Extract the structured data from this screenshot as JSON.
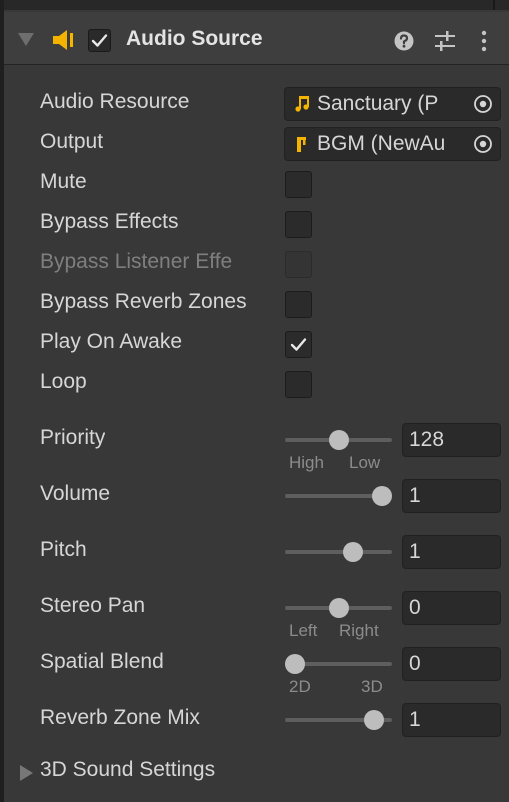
{
  "component": {
    "title": "Audio Source",
    "enabled": true
  },
  "fields": {
    "audio_resource": {
      "label": "Audio Resource",
      "value": "Sanctuary (P"
    },
    "output": {
      "label": "Output",
      "value": "BGM (NewAu"
    },
    "mute": {
      "label": "Mute",
      "checked": false
    },
    "bypass_effects": {
      "label": "Bypass Effects",
      "checked": false
    },
    "bypass_listener_effects": {
      "label": "Bypass Listener Effe",
      "checked": false,
      "disabled": true
    },
    "bypass_reverb_zones": {
      "label": "Bypass Reverb Zones",
      "checked": false
    },
    "play_on_awake": {
      "label": "Play On Awake",
      "checked": true
    },
    "loop": {
      "label": "Loop",
      "checked": false
    },
    "priority": {
      "label": "Priority",
      "value": "128",
      "slider_fraction": 0.5,
      "min_label": "High",
      "max_label": "Low"
    },
    "volume": {
      "label": "Volume",
      "value": "1",
      "slider_fraction": 1.0
    },
    "pitch": {
      "label": "Pitch",
      "value": "1",
      "slider_fraction": 0.67
    },
    "stereo_pan": {
      "label": "Stereo Pan",
      "value": "0",
      "slider_fraction": 0.5,
      "min_label": "Left",
      "max_label": "Right"
    },
    "spatial_blend": {
      "label": "Spatial Blend",
      "value": "0",
      "slider_fraction": 0.0,
      "min_label": "2D",
      "max_label": "3D"
    },
    "reverb_zone_mix": {
      "label": "Reverb Zone Mix",
      "value": "1",
      "slider_fraction": 0.91
    }
  },
  "sections": {
    "sound_3d": {
      "label": "3D Sound Settings",
      "expanded": false
    }
  },
  "icons": {
    "foldout": "triangle-down-icon",
    "component": "speaker-icon",
    "help": "help-icon",
    "presets": "preset-sliders-icon",
    "menu": "kebab-menu-icon",
    "audio_clip": "music-note-icon",
    "mixer_group": "mixer-group-icon",
    "object_picker": "object-picker-icon"
  },
  "colors": {
    "accent": "#f5b400",
    "background": "#383838",
    "field": "#2a2a2a"
  }
}
